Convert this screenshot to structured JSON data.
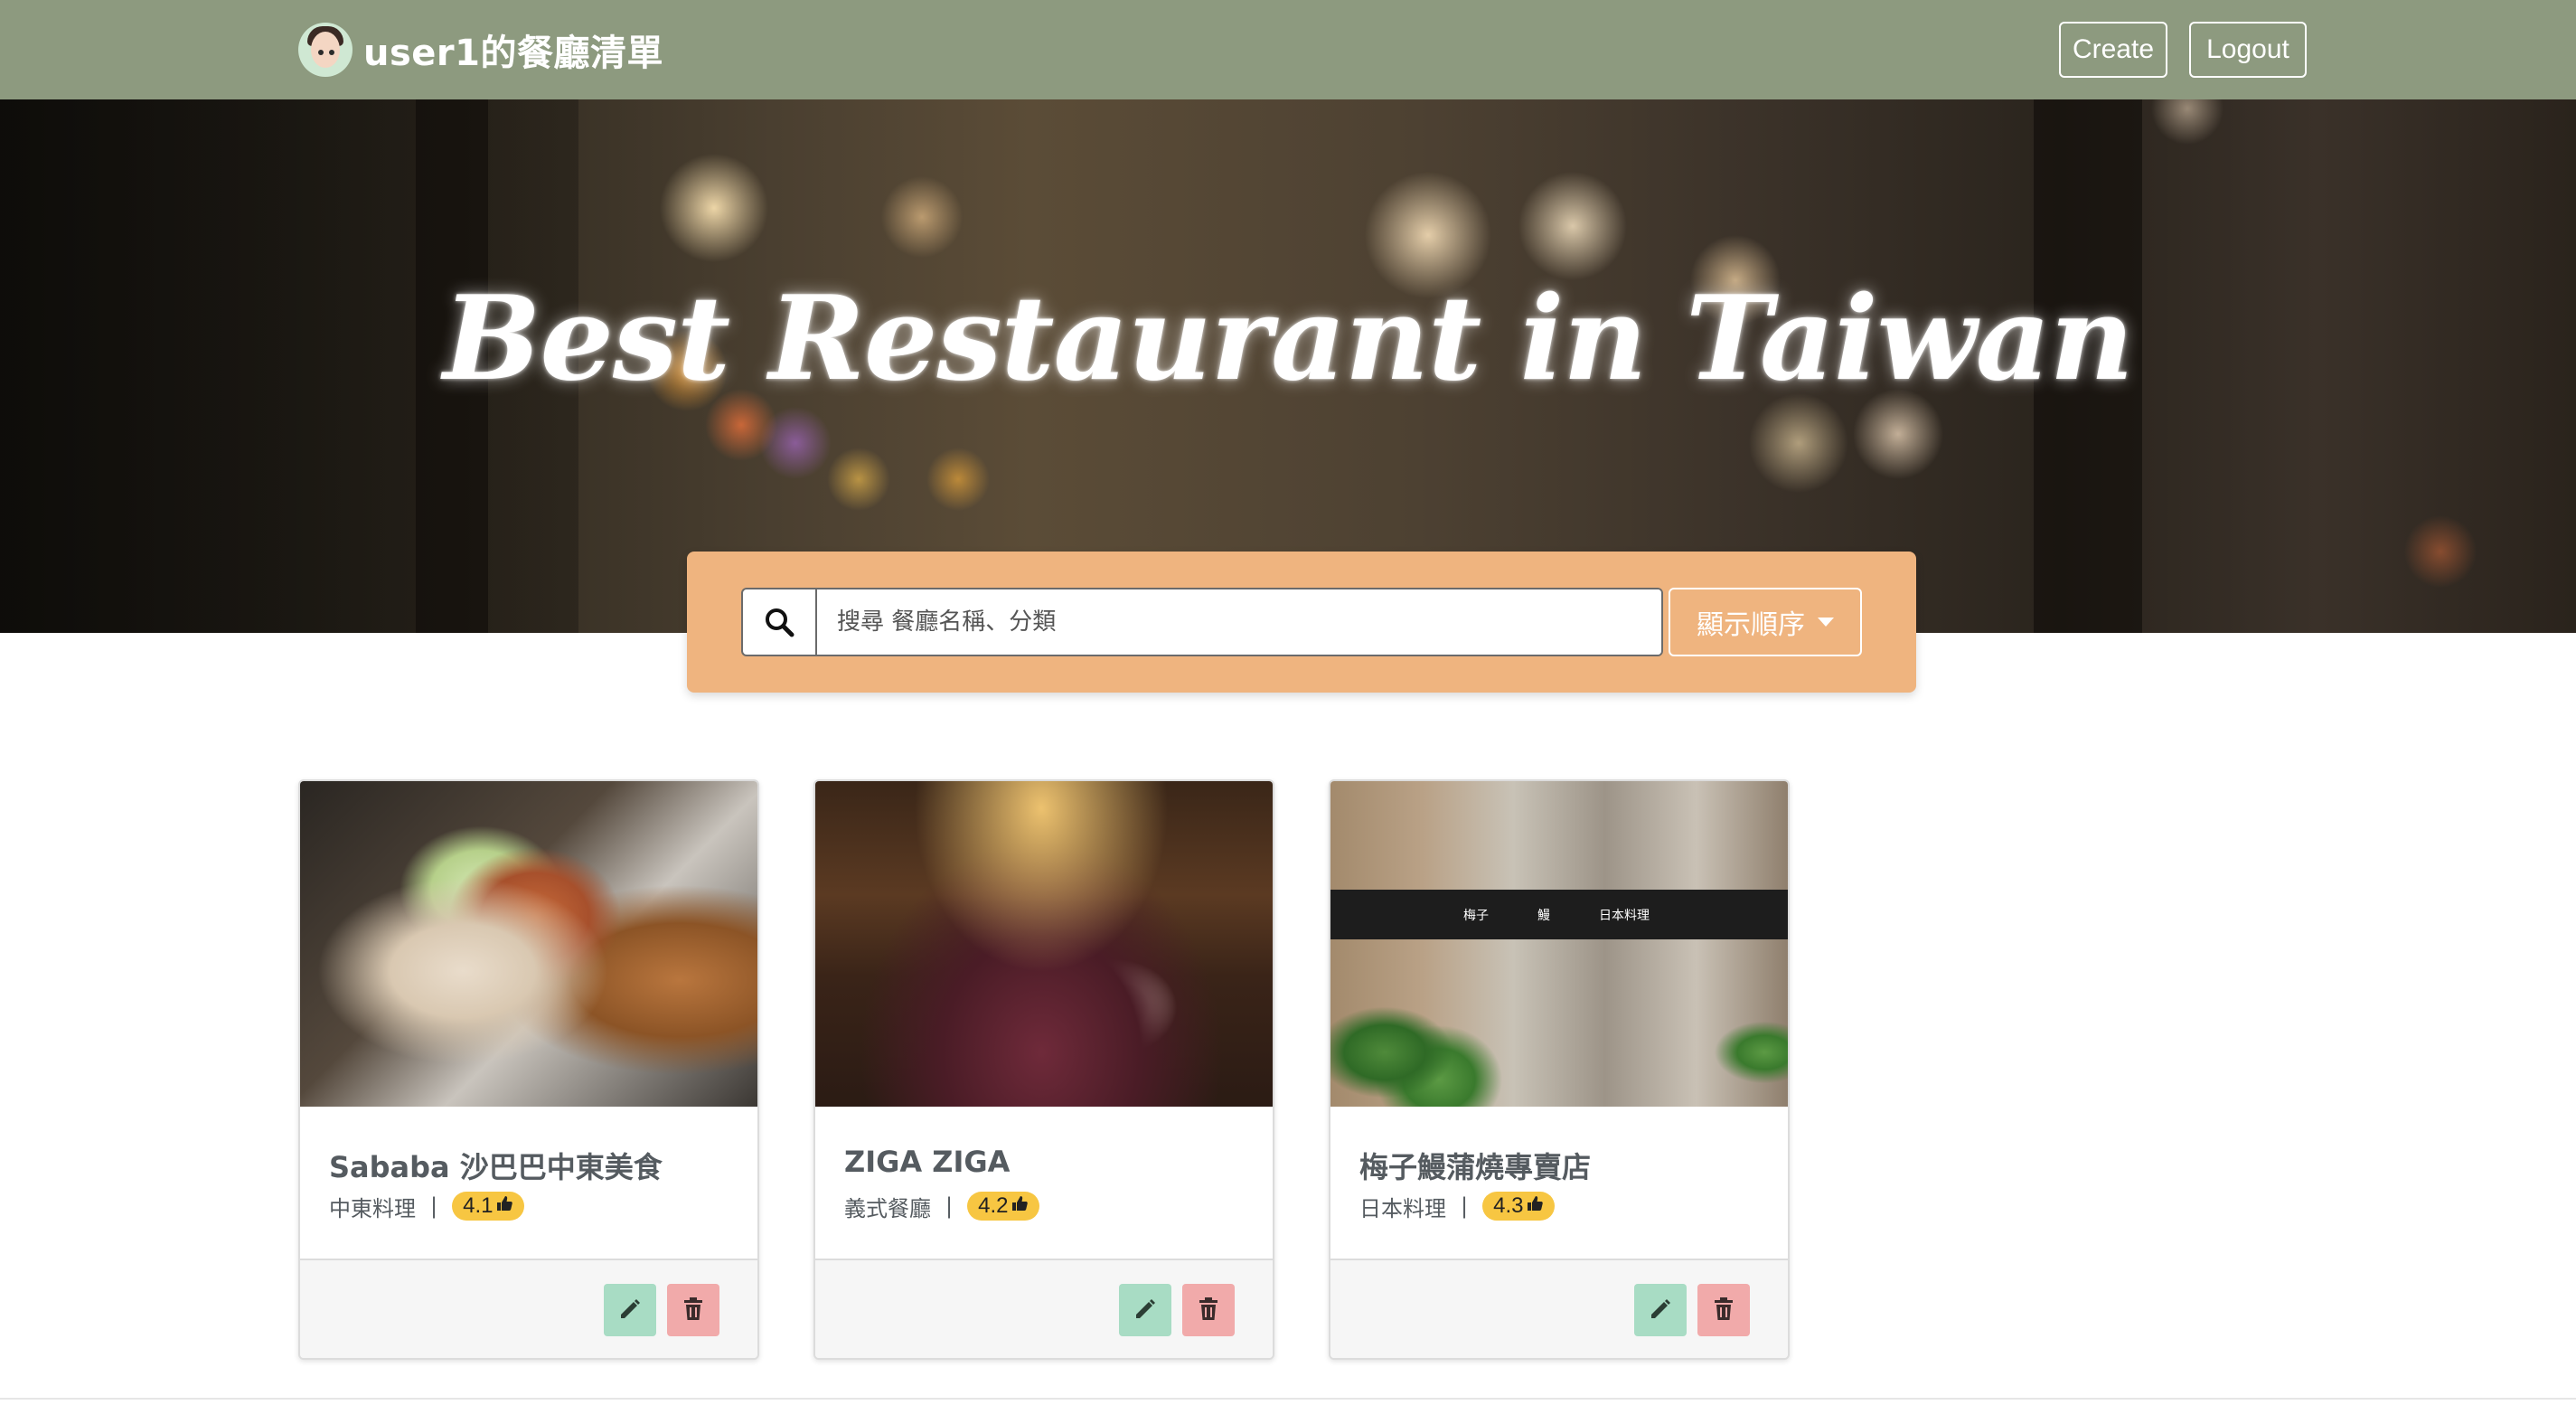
{
  "navbar": {
    "brand": "user1的餐廳清單",
    "create_label": "Create",
    "logout_label": "Logout"
  },
  "hero": {
    "title": "Best Restaurant in Taiwan"
  },
  "search": {
    "placeholder": "搜尋 餐廳名稱、分類",
    "value": "",
    "sort_label": "顯示順序"
  },
  "restaurants": [
    {
      "name": "Sababa 沙巴巴中東美食",
      "category": "中東料理",
      "rating": "4.1"
    },
    {
      "name": "ZIGA ZIGA",
      "category": "義式餐廳",
      "rating": "4.2"
    },
    {
      "name": "梅子鰻蒲燒專賣店",
      "category": "日本料理",
      "rating": "4.3",
      "sign": {
        "left": "梅子",
        "mid": "鰻",
        "right": "日本料理"
      }
    }
  ],
  "colors": {
    "navbar": "#8d9a7f",
    "search_panel": "#efb47f",
    "rating_badge": "#f7c642",
    "edit_button": "#a8dcc4",
    "delete_button": "#f1aaaa"
  },
  "icons": {
    "search": "search-icon",
    "edit": "pencil-icon",
    "delete": "trash-icon",
    "rating": "thumbs-up-icon",
    "dropdown": "caret-down-icon"
  }
}
